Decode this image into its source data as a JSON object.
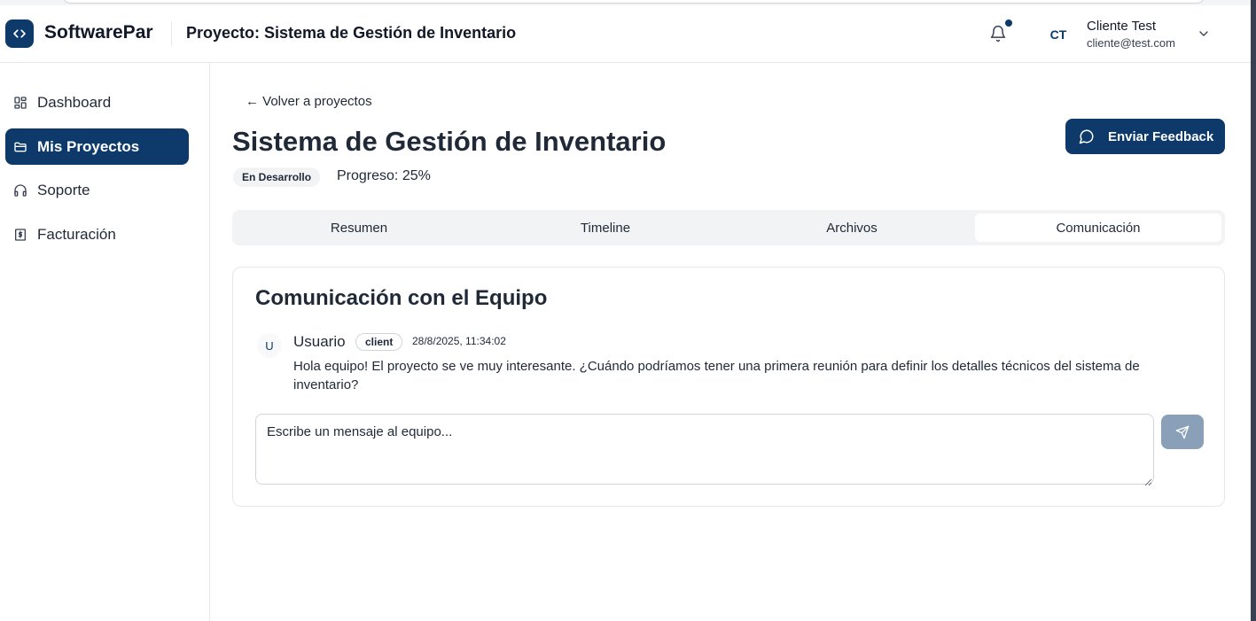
{
  "app": {
    "brand": "SoftwarePar",
    "brand_icon": "code-brackets-icon",
    "accent_color": "#0d3a6b"
  },
  "header": {
    "project_title": "Proyecto: Sistema de Gestión de Inventario",
    "notification_icon": "bell-icon",
    "user": {
      "initials": "CT",
      "name": "Cliente Test",
      "email": "cliente@test.com"
    }
  },
  "sidebar": {
    "items": [
      {
        "label": "Dashboard",
        "icon": "grid-icon",
        "active": false
      },
      {
        "label": "Mis Proyectos",
        "icon": "folder-icon",
        "active": true
      },
      {
        "label": "Soporte",
        "icon": "headphones-icon",
        "active": false
      },
      {
        "label": "Facturación",
        "icon": "dollar-file-icon",
        "active": false
      }
    ]
  },
  "main": {
    "back_link": "← Volver a proyectos",
    "title": "Sistema de Gestión de Inventario",
    "status": "En Desarrollo",
    "progress_label": "Progreso: 25%",
    "progress_value": 25,
    "feedback_button": "Enviar Feedback",
    "tabs": [
      {
        "label": "Resumen",
        "active": false
      },
      {
        "label": "Timeline",
        "active": false
      },
      {
        "label": "Archivos",
        "active": false
      },
      {
        "label": "Comunicación",
        "active": true
      }
    ]
  },
  "communication": {
    "title": "Comunicación con el Equipo",
    "messages": [
      {
        "avatar_initial": "U",
        "author": "Usuario",
        "role": "client",
        "timestamp": "28/8/2025, 11:34:02",
        "text": "Hola equipo! El proyecto se ve muy interesante. ¿Cuándo podríamos tener una primera reunión para definir los detalles técnicos del sistema de inventario?"
      }
    ],
    "input_placeholder": "Escribe un mensaje al equipo...",
    "input_value": "",
    "send_icon": "send-icon"
  }
}
